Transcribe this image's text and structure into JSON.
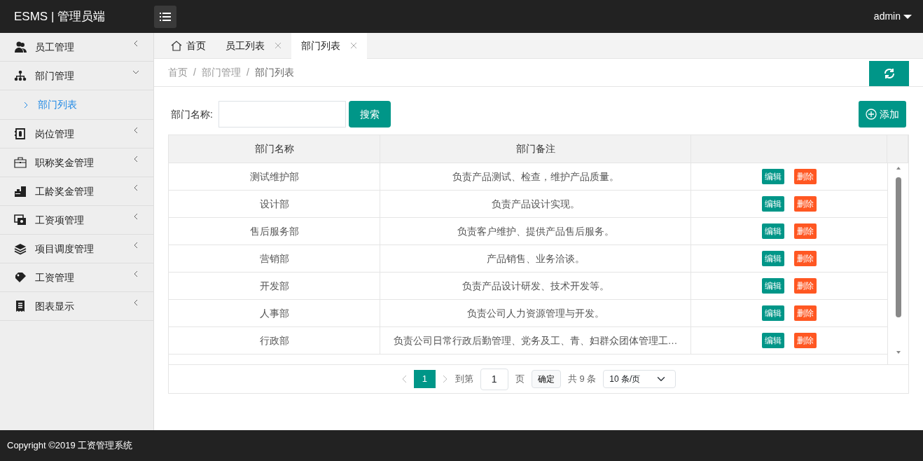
{
  "brand": "ESMS | 管理员端",
  "user": {
    "name": "admin"
  },
  "sidebar": {
    "items": [
      {
        "label": "员工管理",
        "expanded": false
      },
      {
        "label": "部门管理",
        "expanded": true,
        "children": [
          {
            "label": "部门列表",
            "selected": true
          }
        ]
      },
      {
        "label": "岗位管理",
        "expanded": false
      },
      {
        "label": "职称奖金管理",
        "expanded": false
      },
      {
        "label": "工龄奖金管理",
        "expanded": false
      },
      {
        "label": "工资项管理",
        "expanded": false
      },
      {
        "label": "项目调度管理",
        "expanded": false
      },
      {
        "label": "工资管理",
        "expanded": false
      },
      {
        "label": "图表显示",
        "expanded": false
      }
    ]
  },
  "tabs": [
    {
      "label": "首页",
      "kind": "home",
      "selected": false
    },
    {
      "label": "员工列表",
      "kind": "closable",
      "selected": false
    },
    {
      "label": "部门列表",
      "kind": "closable",
      "selected": true
    }
  ],
  "breadcrumb": {
    "items": [
      "首页",
      "部门管理",
      "部门列表"
    ],
    "separator": "/"
  },
  "search": {
    "label": "部门名称:",
    "button": "搜索"
  },
  "add_button": "添加",
  "table": {
    "columns": [
      "部门名称",
      "部门备注"
    ],
    "rows": [
      {
        "name": "测试维护部",
        "note": "负责产品测试、检查，维护产品质量。",
        "actions": [
          "编辑",
          "删除"
        ]
      },
      {
        "name": "设计部",
        "note": "负责产品设计实现。",
        "actions": [
          "编辑",
          "删除"
        ]
      },
      {
        "name": "售后服务部",
        "note": "负责客户维护、提供产品售后服务。",
        "actions": [
          "编辑",
          "删除"
        ]
      },
      {
        "name": "营销部",
        "note": "产品销售、业务洽谈。",
        "actions": [
          "编辑",
          "删除"
        ]
      },
      {
        "name": "开发部",
        "note": "负责产品设计研发、技术开发等。",
        "actions": [
          "编辑",
          "删除"
        ]
      },
      {
        "name": "人事部",
        "note": "负责公司人力资源管理与开发。",
        "actions": [
          "编辑",
          "删除"
        ]
      },
      {
        "name": "行政部",
        "note": "负责公司日常行政后勤管理、党务及工、青、妇群众团体管理工…",
        "actions": [
          "编辑",
          "删除"
        ]
      }
    ]
  },
  "pagination": {
    "pages": [
      {
        "label": "1",
        "selected": true
      }
    ],
    "goto_label": "到第",
    "goto_value": "1",
    "page_unit": "页",
    "confirm": "确定",
    "total": "共 9 条",
    "page_size": "10 条/页"
  },
  "footer": "Copyright ©2019 工资管理系统"
}
